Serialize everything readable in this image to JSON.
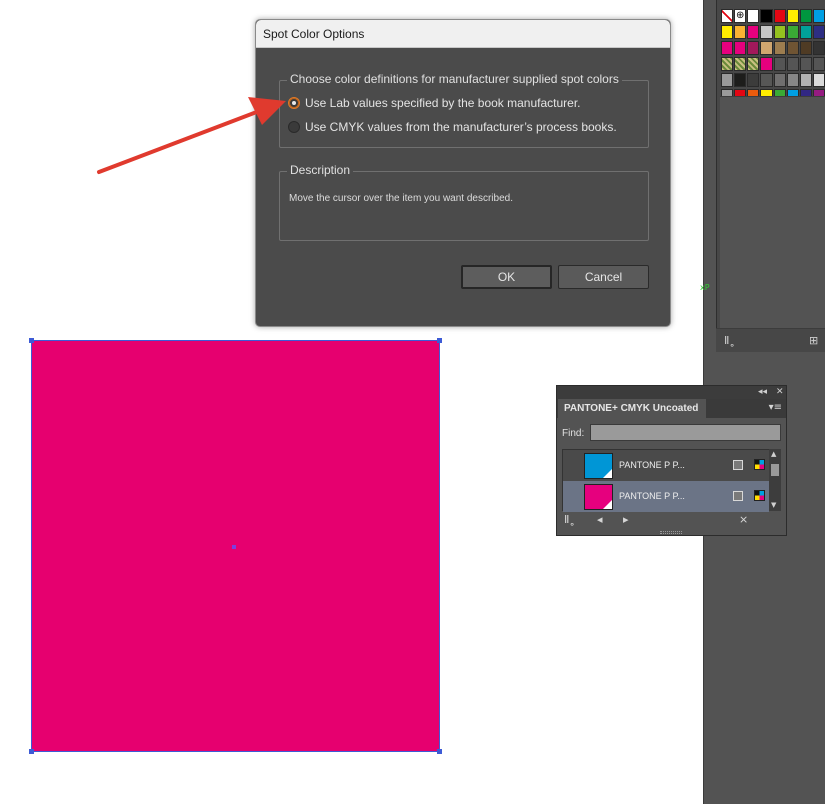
{
  "dialog": {
    "title": "Spot Color Options",
    "group_legend": "Choose color definitions for manufacturer supplied spot colors",
    "options": [
      {
        "label": "Use Lab values specified by the book manufacturer.",
        "selected": true
      },
      {
        "label": "Use CMYK values from the manufacturer’s process books.",
        "selected": false
      }
    ],
    "description_legend": "Description",
    "description_text": "Move the cursor over the item you want described.",
    "ok_label": "OK",
    "cancel_label": "Cancel"
  },
  "pantone_panel": {
    "tab_title": "PANTONE+ CMYK Uncoated",
    "find_label": "Find:",
    "find_value": "",
    "swatches": [
      {
        "name": "PANTONE P P...",
        "color": "#0096d6",
        "selected": false
      },
      {
        "name": "PANTONE P P...",
        "color": "#e6007e",
        "selected": true
      }
    ]
  },
  "artwork": {
    "fill_color": "#e6006f",
    "selection_color": "#3d5bd6"
  },
  "annotation": {
    "arrow_color": "#e03a2e"
  },
  "swatches_panel": {
    "rows": [
      [
        "none",
        "#ffffff-reg",
        "#ffffff",
        "#000000",
        "#e30613",
        "#ffed00",
        "#00963f",
        "#009fe3"
      ],
      [
        "#ffed00",
        "#f9b233",
        "#e6007e",
        "#c6c6c6",
        "#95c11f",
        "#3aaa35",
        "#00a19a",
        "#2d2e83"
      ],
      [
        "#e6007e",
        "#e5007d",
        "#a2195b",
        "#d0a66f",
        "#9d7d4f",
        "#6f5433",
        "#4f3b24",
        "#333333"
      ],
      [
        "pattern1",
        "pattern2",
        "pattern3",
        "#e6007e",
        "empty",
        "empty",
        "empty",
        "empty"
      ],
      [
        "folder",
        "#1d1d1b",
        "#3c3c3b",
        "#575756",
        "#706f6f",
        "#878787",
        "#b2b2b2",
        "#dadada"
      ],
      [
        "folder",
        "#e30613",
        "#ea5b0c",
        "#ffed00",
        "#3aaa35",
        "#009fe3",
        "#312783",
        "#951b81"
      ]
    ]
  },
  "stray_text": "xP"
}
